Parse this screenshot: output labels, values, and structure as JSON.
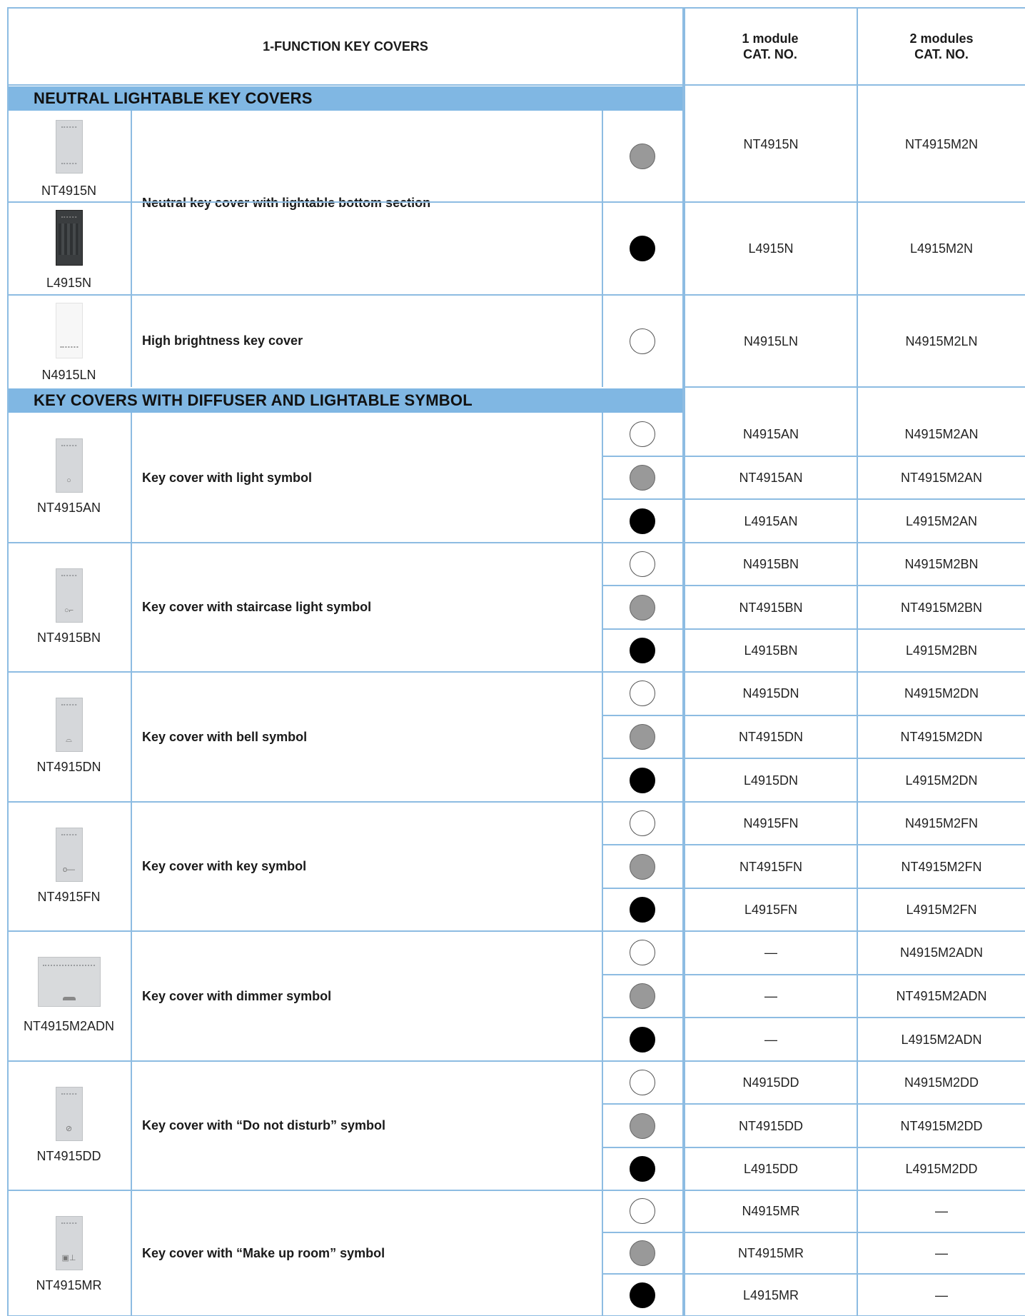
{
  "header": {
    "title": "1-FUNCTION KEY COVERS",
    "col1_line1": "1 module",
    "col1_line2": "CAT. NO.",
    "col2_line1": "2 modules",
    "col2_line2": "CAT. NO."
  },
  "sections": [
    {
      "title": "NEUTRAL LIGHTABLE KEY COVERS"
    },
    {
      "title": "KEY COVERS WITH DIFFUSER AND LIGHTABLE SYMBOL"
    }
  ],
  "colors": {
    "grid": "#8dbce2",
    "band": "#80b7e3",
    "white_finish": "#ffffff",
    "grey_finish": "#999999",
    "black_finish": "#000000"
  },
  "neutral": {
    "desc_main": "Neutral key cover with lightable bottom section",
    "desc_high": "High brightness key cover",
    "rows": [
      {
        "code": "NT4915N",
        "finish": "grey",
        "cat1": "NT4915N",
        "cat2": "NT4915M2N"
      },
      {
        "code": "L4915N",
        "finish": "black",
        "cat1": "L4915N",
        "cat2": "L4915M2N"
      },
      {
        "code": "N4915LN",
        "finish": "white",
        "cat1": "N4915LN",
        "cat2": "N4915M2LN"
      }
    ]
  },
  "groups": [
    {
      "code": "NT4915AN",
      "desc": "Key cover with light symbol",
      "symbol_icon": "light-symbol-icon",
      "rows": [
        {
          "finish": "white",
          "cat1": "N4915AN",
          "cat2": "N4915M2AN"
        },
        {
          "finish": "grey",
          "cat1": "NT4915AN",
          "cat2": "NT4915M2AN"
        },
        {
          "finish": "black",
          "cat1": "L4915AN",
          "cat2": "L4915M2AN"
        }
      ]
    },
    {
      "code": "NT4915BN",
      "desc": "Key cover with staircase light symbol",
      "symbol_icon": "staircase-light-symbol-icon",
      "rows": [
        {
          "finish": "white",
          "cat1": "N4915BN",
          "cat2": "N4915M2BN"
        },
        {
          "finish": "grey",
          "cat1": "NT4915BN",
          "cat2": "NT4915M2BN"
        },
        {
          "finish": "black",
          "cat1": "L4915BN",
          "cat2": "L4915M2BN"
        }
      ]
    },
    {
      "code": "NT4915DN",
      "desc": "Key cover with bell symbol",
      "symbol_icon": "bell-symbol-icon",
      "rows": [
        {
          "finish": "white",
          "cat1": "N4915DN",
          "cat2": "N4915M2DN"
        },
        {
          "finish": "grey",
          "cat1": "NT4915DN",
          "cat2": "NT4915M2DN"
        },
        {
          "finish": "black",
          "cat1": "L4915DN",
          "cat2": "L4915M2DN"
        }
      ]
    },
    {
      "code": "NT4915FN",
      "desc": "Key cover with key symbol",
      "symbol_icon": "key-symbol-icon",
      "rows": [
        {
          "finish": "white",
          "cat1": "N4915FN",
          "cat2": "N4915M2FN"
        },
        {
          "finish": "grey",
          "cat1": "NT4915FN",
          "cat2": "NT4915M2FN"
        },
        {
          "finish": "black",
          "cat1": "L4915FN",
          "cat2": "L4915M2FN"
        }
      ]
    },
    {
      "code": "NT4915M2ADN",
      "desc": "Key cover with dimmer symbol",
      "symbol_icon": "dimmer-symbol-icon",
      "rows": [
        {
          "finish": "white",
          "cat1": "—",
          "cat2": "N4915M2ADN"
        },
        {
          "finish": "grey",
          "cat1": "—",
          "cat2": "NT4915M2ADN"
        },
        {
          "finish": "black",
          "cat1": "—",
          "cat2": "L4915M2ADN"
        }
      ]
    },
    {
      "code": "NT4915DD",
      "desc": "Key cover with “Do not disturb” symbol",
      "symbol_icon": "do-not-disturb-symbol-icon",
      "rows": [
        {
          "finish": "white",
          "cat1": "N4915DD",
          "cat2": "N4915M2DD"
        },
        {
          "finish": "grey",
          "cat1": "NT4915DD",
          "cat2": "NT4915M2DD"
        },
        {
          "finish": "black",
          "cat1": "L4915DD",
          "cat2": "L4915M2DD"
        }
      ]
    },
    {
      "code": "NT4915MR",
      "desc": "Key cover with “Make up room” symbol",
      "symbol_icon": "make-up-room-symbol-icon",
      "rows": [
        {
          "finish": "white",
          "cat1": "N4915MR",
          "cat2": "—"
        },
        {
          "finish": "grey",
          "cat1": "NT4915MR",
          "cat2": "—"
        },
        {
          "finish": "black",
          "cat1": "L4915MR",
          "cat2": "—"
        }
      ]
    }
  ]
}
